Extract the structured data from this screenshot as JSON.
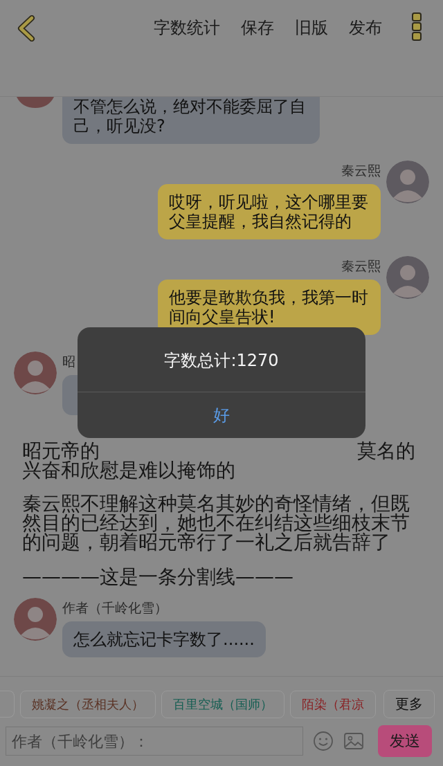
{
  "header": {
    "actions": [
      {
        "label": "字数统计"
      },
      {
        "label": "保存"
      },
      {
        "label": "旧版"
      },
      {
        "label": "发布"
      }
    ]
  },
  "feed": [
    {
      "kind": "incoming",
      "text": "不管怎么说，绝对不能委屈了自己，听见没?"
    },
    {
      "kind": "outgoing",
      "name": "秦云熙",
      "text": "哎呀，听见啦，这个哪里要父皇提醒，我自然记得的"
    },
    {
      "kind": "outgoing",
      "name": "秦云熙",
      "text": "他要是敢欺负我，我第一时间向父皇告状!"
    },
    {
      "kind": "incoming",
      "name": "昭"
    },
    {
      "kind": "narration",
      "covered_start": "昭元帝的",
      "covered_end": "莫名的",
      "text": "兴奋和欣慰是难以掩饰的"
    },
    {
      "kind": "narration",
      "text": "秦云熙不理解这种莫名其妙的奇怪情绪，但既然目的已经达到，她也不在纠结这些细枝末节的问题，朝着昭元帝行了一礼之后就告辞了"
    },
    {
      "kind": "divider",
      "text": "————这是一条分割线———"
    },
    {
      "kind": "incoming",
      "name": "作者（千岭化雪）",
      "text": "怎么就忘记卡字数了......"
    }
  ],
  "roles": [
    {
      "label": "姚凝之（丞相夫人）",
      "color": "#5a3224"
    },
    {
      "label": "百里空城（国师）",
      "color": "#145e52"
    },
    {
      "label": "陌染（君凉",
      "color": "#8a1f22"
    }
  ],
  "more_button": "更多",
  "composer": {
    "placeholder": "作者（千岭化雪）：",
    "send": "发送"
  },
  "dialog": {
    "title": "字数总计:1270",
    "button": "好"
  }
}
